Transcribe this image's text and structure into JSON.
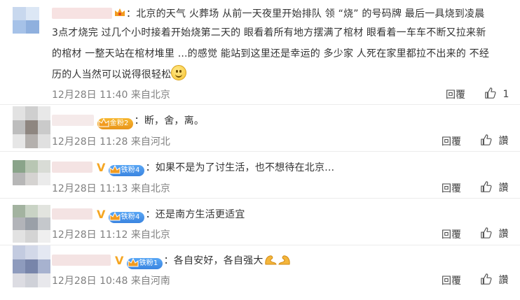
{
  "comments": [
    {
      "lines": [
        "：北京的天气 火葬场 从前一天夜里开始排队 领 “烧” 的号码牌 最后一具烧到凌晨",
        "3点才烧完 过几个小时接着开始烧第二天的 眼看着所有地方摆满了棺材 眼看着一车车不断又拉来新",
        "的棺材 一整天站在棺材堆里 ...的感觉 能站到这里还是幸运的 多少家 人死在家里都拉不出来的 不经",
        "历的人当然可以说得很轻松"
      ],
      "date": "12月28日 11:40",
      "location": "来自北京",
      "reply_label": "回覆",
      "like_count": "1",
      "emoji_name": "smile-emoji",
      "badge_icon": "crown-icon"
    },
    {
      "badge": "金粉2",
      "text": "：断，舍，离。",
      "date": "12月28日 11:28",
      "location": "来自河北",
      "reply_label": "回覆",
      "like_label": "讚"
    },
    {
      "verified": "V",
      "badge": "铁粉4",
      "text": "：如果不是为了讨生活，也不想待在北京…",
      "date": "12月28日 11:13",
      "location": "来自北京",
      "reply_label": "回覆",
      "like_label": "讚"
    },
    {
      "verified": "V",
      "badge": "铁粉4",
      "text": "：还是南方生活更适宜",
      "date": "12月28日 11:12",
      "location": "来自北京",
      "reply_label": "回覆",
      "like_label": "讚"
    },
    {
      "verified": "V",
      "badge": "铁粉1",
      "text": "：各自安好，各自强大",
      "emoji_name": "flexed-biceps-emoji",
      "date": "12月28日 10:48",
      "location": "来自河南",
      "reply_label": "回覆",
      "like_label": "讚"
    }
  ],
  "colors": {
    "meta_text": "#808080",
    "badge_gold": "#f0a825",
    "badge_blue": "#4a94ea",
    "verified_v": "#f5a623"
  }
}
